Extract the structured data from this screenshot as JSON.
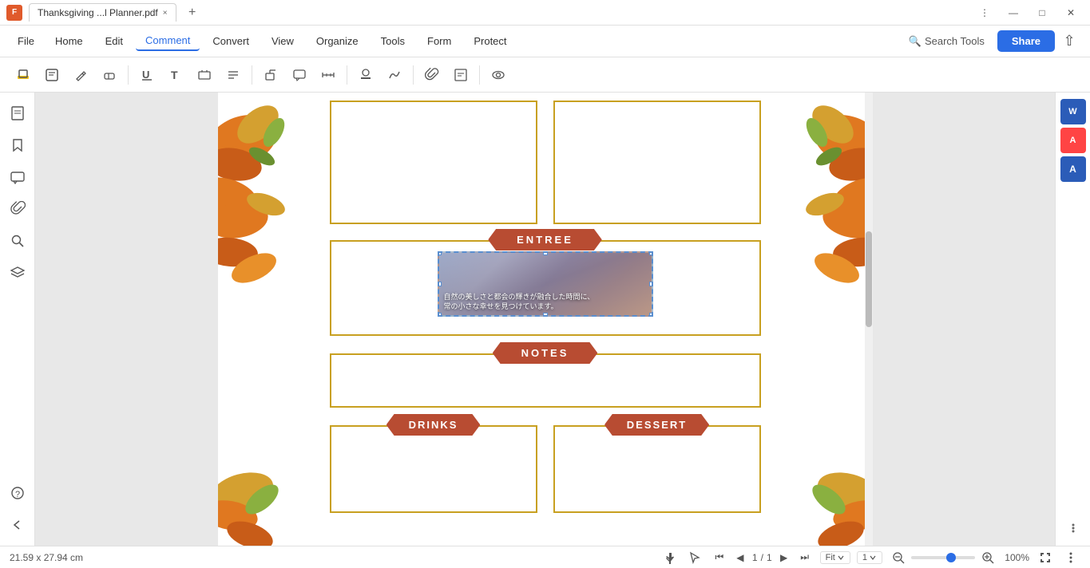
{
  "titlebar": {
    "app_icon": "F",
    "tab_title": "Thanksgiving ...l Planner.pdf",
    "close_label": "×",
    "new_tab_label": "+"
  },
  "window_controls": {
    "minimize": "—",
    "maximize": "□",
    "close": "✕",
    "menu": "⋮"
  },
  "menubar": {
    "file": "File",
    "home": "Home",
    "edit": "Edit",
    "comment": "Comment",
    "convert": "Convert",
    "view": "View",
    "organize": "Organize",
    "tools": "Tools",
    "form": "Form",
    "protect": "Protect",
    "search_tools": "Search Tools",
    "share": "Share"
  },
  "toolbar": {
    "tools": [
      "✏",
      "⬜",
      "✒",
      "◻",
      "U̲",
      "T",
      "⊞",
      "≡",
      "▭",
      "💬",
      "📏",
      "✋",
      "✒",
      "📎",
      "✏",
      "👁"
    ]
  },
  "sidebar_left": {
    "icons": [
      "📄",
      "🔖",
      "💬",
      "📎",
      "🔍",
      "⊞",
      "?"
    ]
  },
  "sidebar_right": {
    "icons": [
      "W",
      "A",
      "A"
    ]
  },
  "planner": {
    "sections": {
      "entree_label": "ENTREE",
      "notes_label": "NOTES",
      "drinks_label": "DRINKS",
      "dessert_label": "DESSERT"
    },
    "image_text_line1": "自然の美しさと都会の輝きが融合した時間に、",
    "image_text_line2": "常の小さな幸せを見つけています。"
  },
  "statusbar": {
    "dimensions": "21.59 x 27.94 cm",
    "page_current": "1",
    "page_total": "1",
    "zoom": "100%",
    "zoom_percent": "100"
  }
}
